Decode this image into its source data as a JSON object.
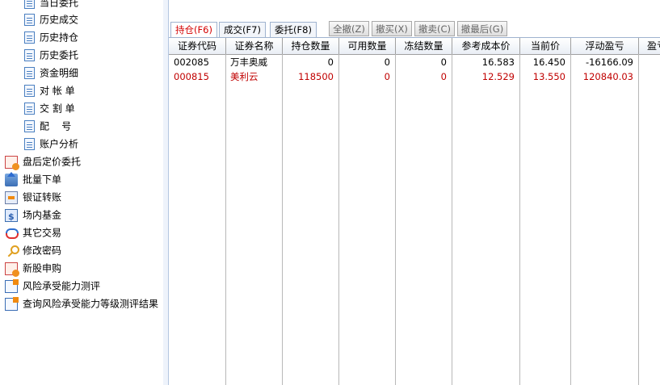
{
  "nav": {
    "sub_items": [
      {
        "label": "当日委托",
        "icon": "document-icon"
      },
      {
        "label": "历史成交",
        "icon": "document-icon"
      },
      {
        "label": "历史持仓",
        "icon": "document-icon"
      },
      {
        "label": "历史委托",
        "icon": "document-icon"
      },
      {
        "label": "资金明细",
        "icon": "document-icon"
      },
      {
        "label": "对 帐 单",
        "icon": "document-icon"
      },
      {
        "label": "交 割 单",
        "icon": "document-icon"
      },
      {
        "label": "配    号",
        "icon": "document-icon"
      },
      {
        "label": "账户分析",
        "icon": "document-icon"
      }
    ],
    "top_items": [
      {
        "label": "盘后定价委托",
        "icon": "after-hours-order-icon"
      },
      {
        "label": "批量下单",
        "icon": "batch-order-icon"
      },
      {
        "label": "银证转账",
        "icon": "bank-transfer-icon"
      },
      {
        "label": "场内基金",
        "icon": "fund-icon"
      },
      {
        "label": "其它交易",
        "icon": "other-trade-icon"
      },
      {
        "label": "修改密码",
        "icon": "key-icon"
      },
      {
        "label": "新股申购",
        "icon": "ipo-subscribe-icon"
      },
      {
        "label": "风险承受能力测评",
        "icon": "risk-assessment-icon"
      },
      {
        "label": "查询风险承受能力等级测评结果",
        "icon": "risk-result-icon"
      }
    ]
  },
  "tabs": [
    {
      "label": "持仓(F6)",
      "active": true
    },
    {
      "label": "成交(F7)",
      "active": false
    },
    {
      "label": "委托(F8)",
      "active": false
    }
  ],
  "action_buttons": [
    {
      "label": "全撤(Z)"
    },
    {
      "label": "撤买(X)"
    },
    {
      "label": "撤卖(C)"
    },
    {
      "label": "撤最后(G)"
    }
  ],
  "table": {
    "headers": [
      "证券代码",
      "证券名称",
      "持仓数量",
      "可用数量",
      "冻结数量",
      "参考成本价",
      "当前价",
      "浮动盈亏",
      "盈亏"
    ],
    "rows": [
      {
        "cells": [
          "002085",
          "万丰奥威",
          "0",
          "0",
          "0",
          "16.583",
          "16.450",
          "-16166.09"
        ],
        "color": "#000000"
      },
      {
        "cells": [
          "000815",
          "美利云",
          "118500",
          "0",
          "0",
          "12.529",
          "13.550",
          "120840.03"
        ],
        "color": "#c00000"
      }
    ]
  },
  "colors": {
    "active_tab": "#d40000",
    "gain_row": "#c00000",
    "panel_border": "#9fb3cf"
  }
}
